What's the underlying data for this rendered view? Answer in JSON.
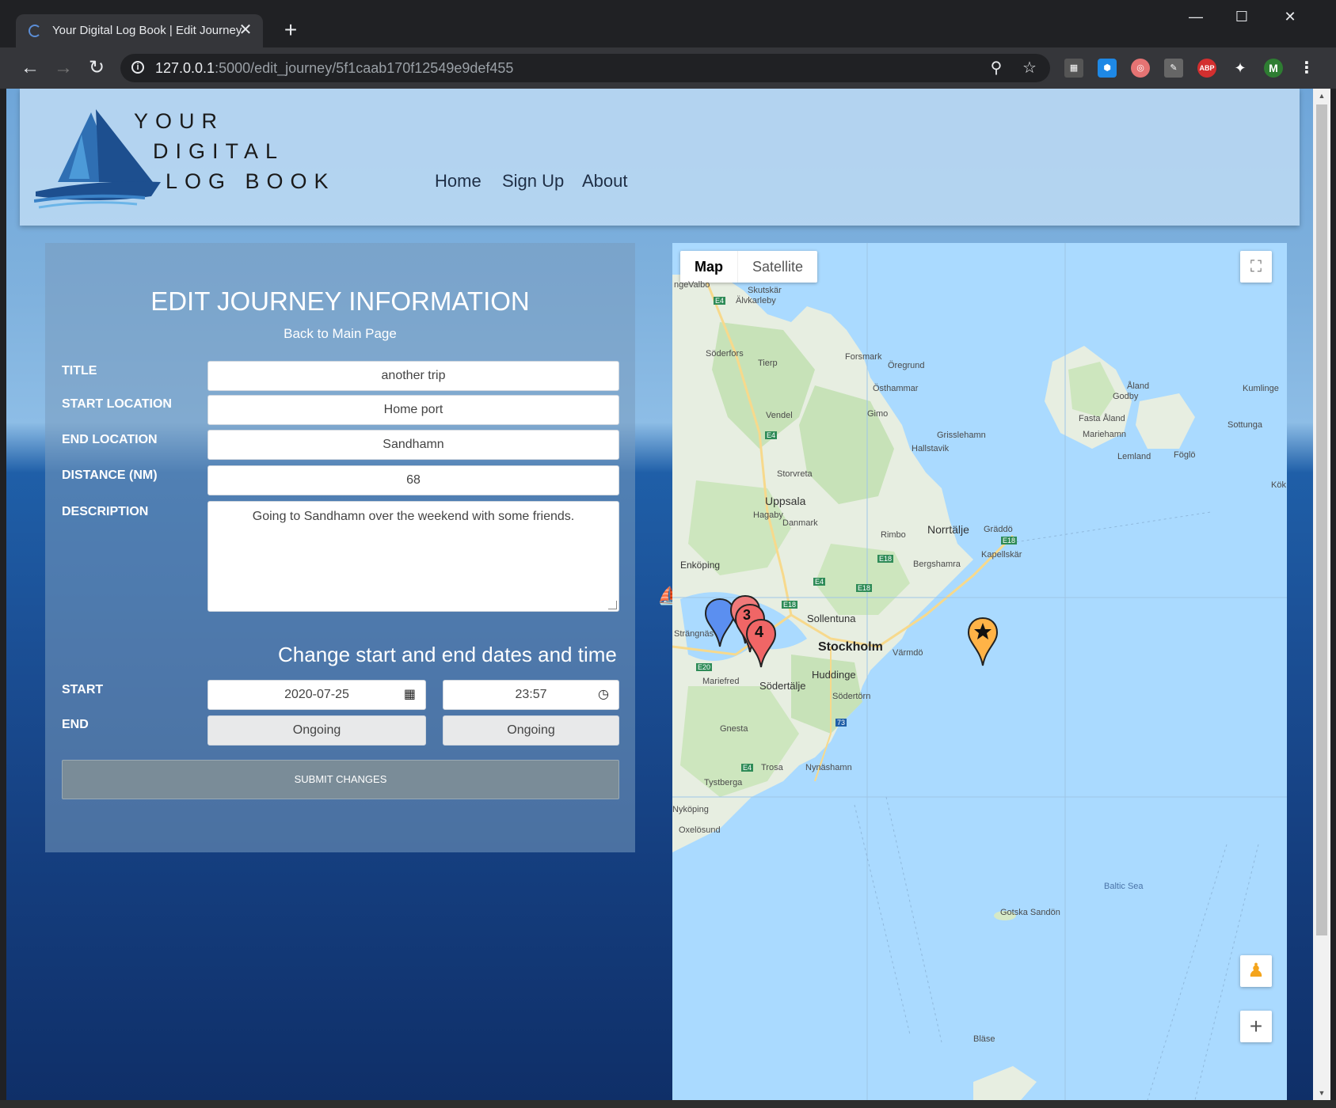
{
  "browser": {
    "tab_title": "Your Digital Log Book | Edit Journey",
    "url_host": "127.0.0.1",
    "url_rest": ":5000/edit_journey/5f1caab170f12549e9def455",
    "profile_initial": "M",
    "abp_label": "ABP"
  },
  "header": {
    "brand_line1": "YOUR",
    "brand_line2": "DIGITAL",
    "brand_line3": "LOG BOOK",
    "nav": [
      "Home",
      "Sign Up",
      "About"
    ]
  },
  "form": {
    "heading": "EDIT JOURNEY INFORMATION",
    "back_link": "Back to Main Page",
    "fields": [
      {
        "label": "TITLE",
        "value": "another trip"
      },
      {
        "label": "START LOCATION",
        "value": "Home port"
      },
      {
        "label": "END LOCATION",
        "value": "Sandhamn"
      },
      {
        "label": "DISTANCE (NM)",
        "value": "68"
      },
      {
        "label": "DESCRIPTION",
        "value": "Going to Sandhamn over the weekend with some friends."
      }
    ],
    "dates_heading": "Change start and end dates and time",
    "start_label": "START",
    "start_date": "2020-07-25",
    "start_time": "23:57",
    "end_label": "END",
    "end_date": "Ongoing",
    "end_time": "Ongoing",
    "submit": "SUBMIT CHANGES"
  },
  "map": {
    "type_map": "Map",
    "type_satellite": "Satellite",
    "markers": [
      "3",
      "4"
    ],
    "places": {
      "valbo": "Valbo",
      "skutskar": "Skutskär",
      "alvkarleby": "Älvkarleby",
      "soderfors": "Söderfors",
      "tierp": "Tierp",
      "forsmark": "Forsmark",
      "oregrund": "Öregrund",
      "osthammar": "Östhammar",
      "vendel": "Vendel",
      "gimo": "Gimo",
      "grisslehamn": "Grisslehamn",
      "hallstavik": "Hallstavik",
      "storvreta": "Storvreta",
      "uppsala": "Uppsala",
      "hagaby": "Hagaby",
      "danmark": "Danmark",
      "rimbo": "Rimbo",
      "norrtalje": "Norrtälje",
      "gräddö": "Gräddö",
      "kapellskar": "Kapellskär",
      "bergshamra": "Bergshamra",
      "enkoping": "Enköping",
      "strangnas": "Strängnäs",
      "sollentuna": "Sollentuna",
      "stockholm": "Stockholm",
      "varmdo": "Värmdö",
      "huddinge": "Huddinge",
      "mariefred": "Mariefred",
      "sodertalje": "Södertälje",
      "sodertorn": "Södertörn",
      "gnesta": "Gnesta",
      "trosa": "Trosa",
      "nynashamn": "Nynäshamn",
      "tystberga": "Tystberga",
      "nykoping": "Nyköping",
      "oxelosund": "Oxelösund",
      "aland": "Åland",
      "godby": "Godby",
      "kumlinge": "Kumlinge",
      "fasta_aland": "Fasta Åland",
      "mariehamn": "Mariehamn",
      "sottunga": "Sottunga",
      "lemland": "Lemland",
      "foglo": "Föglö",
      "kok": "Kök",
      "baltic_sea": "Baltic Sea",
      "gotska_sandon": "Gotska Sandön",
      "blase": "Bläse",
      "nge": "nge"
    },
    "roads": {
      "e4": "E4",
      "e18": "E18",
      "e20": "E20",
      "r73": "73"
    }
  },
  "colors": {
    "header_bg": "#b9d7f2",
    "submit_bg": "#7a8c98",
    "marker_blue": "#5b8ff0",
    "marker_red": "#f06666",
    "marker_orange": "#ffb347"
  }
}
